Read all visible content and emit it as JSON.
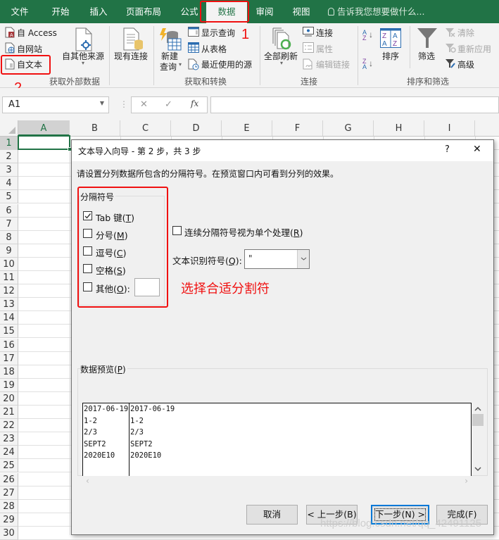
{
  "ribbon_tabs": [
    {
      "label": "文件",
      "active": false
    },
    {
      "label": "开始",
      "active": false
    },
    {
      "label": "插入",
      "active": false
    },
    {
      "label": "页面布局",
      "active": false
    },
    {
      "label": "公式",
      "active": false
    },
    {
      "label": "数据",
      "active": true
    },
    {
      "label": "审阅",
      "active": false
    },
    {
      "label": "视图",
      "active": false
    }
  ],
  "tell_me": {
    "icon": "lightbulb-icon",
    "placeholder": "告诉我您想要做什么..."
  },
  "ribbon": {
    "get_external": {
      "group_label": "获取外部数据",
      "from_access": "自 Access",
      "from_web": "自网站",
      "from_text": "自文本",
      "from_other": "自其他来源",
      "existing": "现有连接"
    },
    "get_transform": {
      "group_label": "获取和转换",
      "new_query_line1": "新建",
      "new_query_line2": "查询",
      "show_queries": "显示查询",
      "from_table": "从表格",
      "recent_sources": "最近使用的源"
    },
    "connections": {
      "group_label": "连接",
      "refresh_all": "全部刷新",
      "connections": "连接",
      "properties": "属性",
      "edit_links": "编辑链接"
    },
    "sort_filter": {
      "group_label": "排序和筛选",
      "sort": "排序",
      "filter": "筛选",
      "clear": "清除",
      "reapply": "重新应用",
      "advanced": "高级"
    }
  },
  "annotations": {
    "step1": "1",
    "step2": "2",
    "hint": "选择合适分割符",
    "accent": "#f01010"
  },
  "formula_bar": {
    "name_box": "A1",
    "cancel": "✕",
    "enter": "✓",
    "fx": "fx",
    "value": ""
  },
  "columns": [
    "A",
    "B",
    "C",
    "D",
    "E",
    "F",
    "G",
    "H",
    "I"
  ],
  "rows": [
    "1",
    "2",
    "3",
    "4",
    "5",
    "6",
    "7",
    "8",
    "9",
    "10",
    "11",
    "12",
    "13",
    "14",
    "15",
    "16",
    "17",
    "18",
    "19",
    "20",
    "21",
    "22",
    "23",
    "24",
    "25",
    "26",
    "27",
    "28",
    "29",
    "30"
  ],
  "dialog": {
    "title": "文本导入向导 - 第 2 步，共 3 步",
    "help": "?",
    "close": "✕",
    "instruction": "请设置分列数据所包含的分隔符号。在预览窗口内可看到分列的效果。",
    "delimiters_label": "分隔符号",
    "delimiters": [
      {
        "label": "Tab 键",
        "key": "T",
        "checked": true
      },
      {
        "label": "分号",
        "key": "M",
        "checked": false
      },
      {
        "label": "逗号",
        "key": "C",
        "checked": false
      },
      {
        "label": "空格",
        "key": "S",
        "checked": false
      },
      {
        "label": "其他",
        "key": "O",
        "checked": false,
        "suffix": ":"
      }
    ],
    "other_value": "",
    "consecutive": {
      "label": "连续分隔符号视为单个处理",
      "key": "R",
      "checked": false
    },
    "qualifier": {
      "label": "文本识别符号",
      "key": "Q",
      "value": "\""
    },
    "preview_label": "数据预览",
    "preview_key": "P",
    "preview_rows": [
      [
        "2017-06-19",
        "2017-06-19"
      ],
      [
        "1-2",
        "1-2"
      ],
      [
        "2/3",
        "2/3"
      ],
      [
        "SEPT2",
        "SEPT2"
      ],
      [
        "2020E10",
        "2020E10"
      ]
    ],
    "buttons": {
      "cancel": "取消",
      "back": "< 上一步(B)",
      "next": "下一步(N) >",
      "finish": "完成(F)"
    }
  },
  "watermark": "https://blog.csdn.net/qq_42491125"
}
